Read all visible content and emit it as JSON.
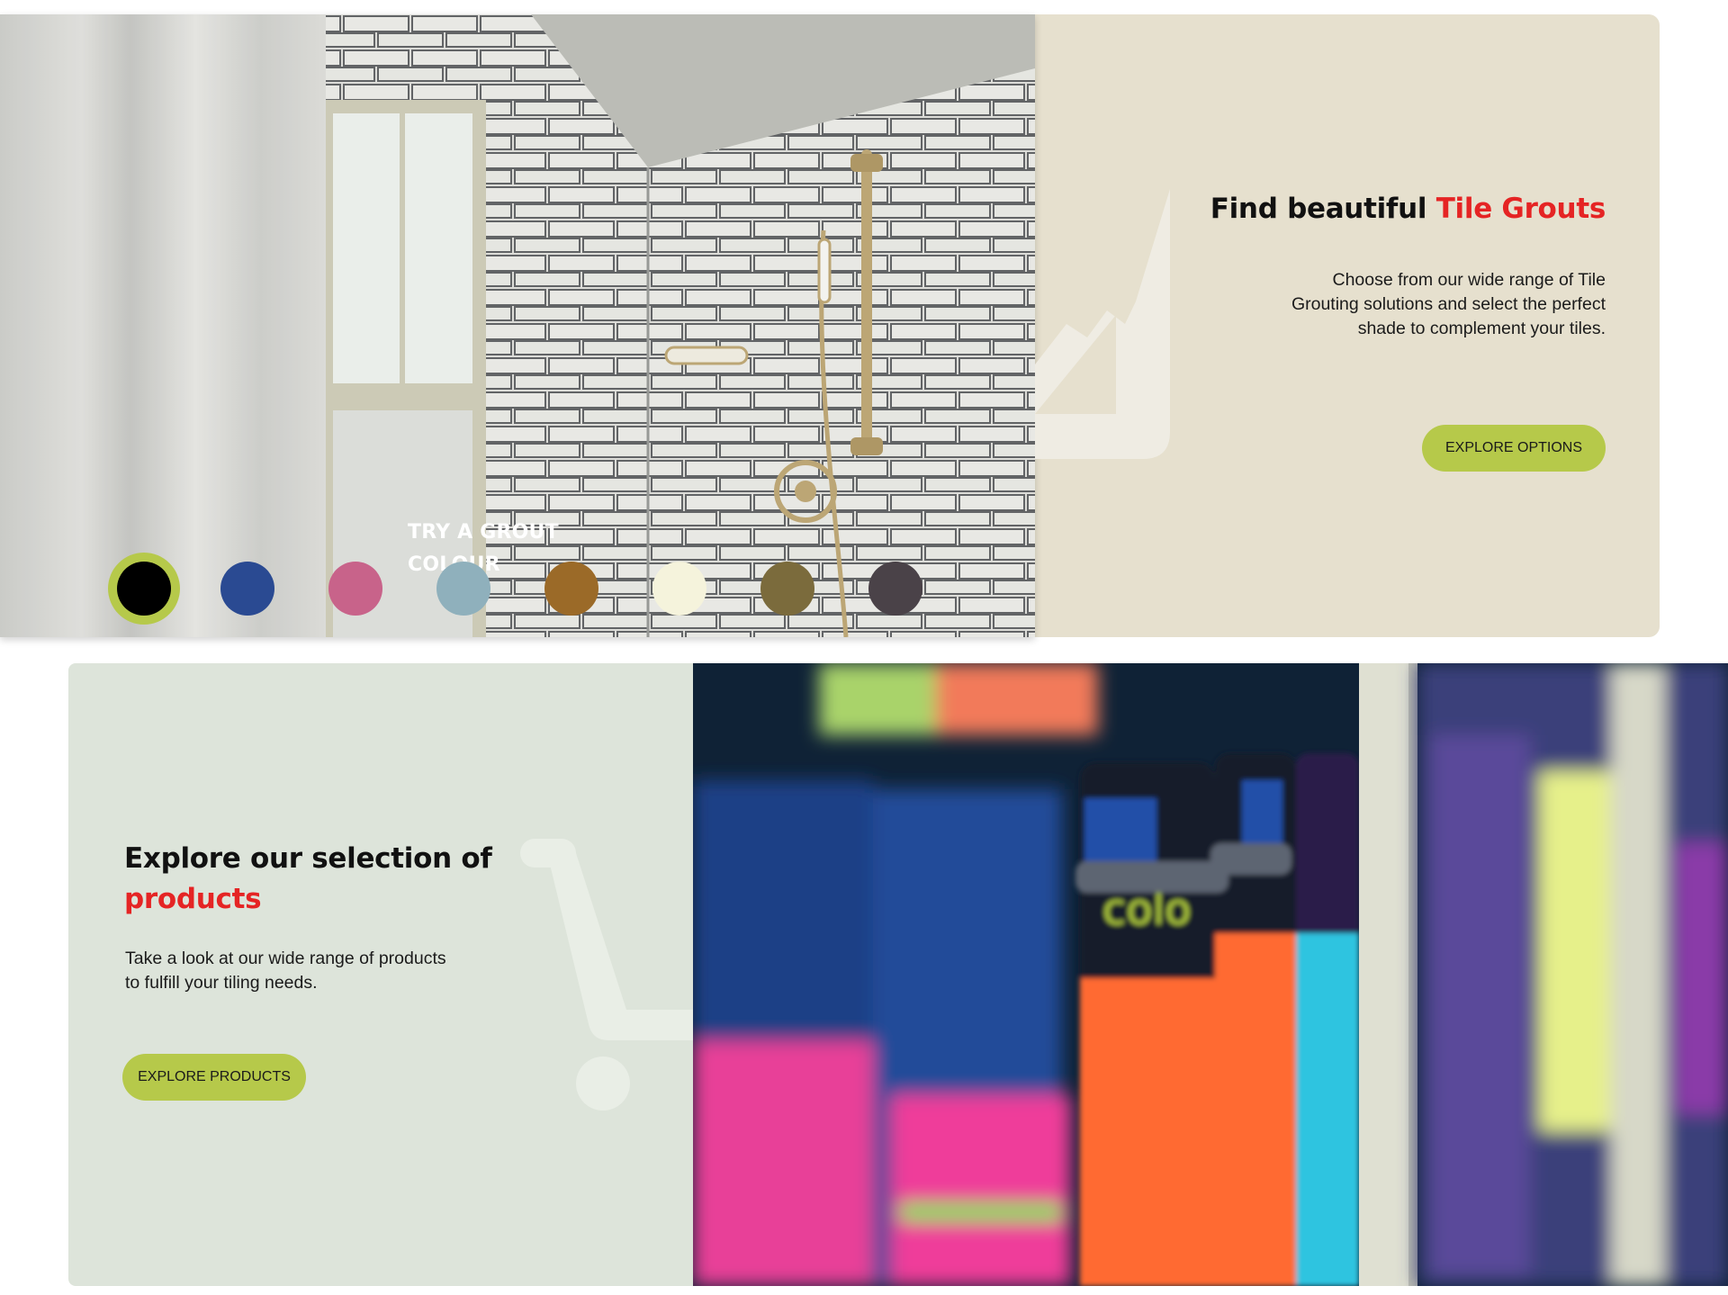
{
  "grout_section": {
    "try_label": "TRY A GROUT COLOUR",
    "title_prefix": "Find beautiful ",
    "title_highlight": "Tile Grouts",
    "description": "Choose from our wide range of Tile Grouting solutions and select the perfect shade to complement your tiles.",
    "button_label": "EXPLORE OPTIONS",
    "icon": "grout-trowel-icon",
    "swatches": [
      {
        "color": "#000000",
        "selected": true
      },
      {
        "color": "#2a4a92",
        "selected": false
      },
      {
        "color": "#c8638a",
        "selected": false
      },
      {
        "color": "#8fb0bc",
        "selected": false
      },
      {
        "color": "#9b6a28",
        "selected": false
      },
      {
        "color": "#f5f3dc",
        "selected": false
      },
      {
        "color": "#7b6b3c",
        "selected": false
      },
      {
        "color": "#4a4248",
        "selected": false
      }
    ]
  },
  "products_section": {
    "title_prefix": "Explore our selection of ",
    "title_highlight": "products",
    "description": "Take a look at our wide range of products to fulfill your tiling needs.",
    "button_label": "EXPLORE PRODUCTS",
    "icon": "shopping-cart-icon"
  },
  "colors": {
    "accent_red": "#e52424",
    "button_green": "#b6c94a",
    "grout_panel_bg": "#e6e0ce",
    "products_panel_bg": "#dde4da"
  }
}
